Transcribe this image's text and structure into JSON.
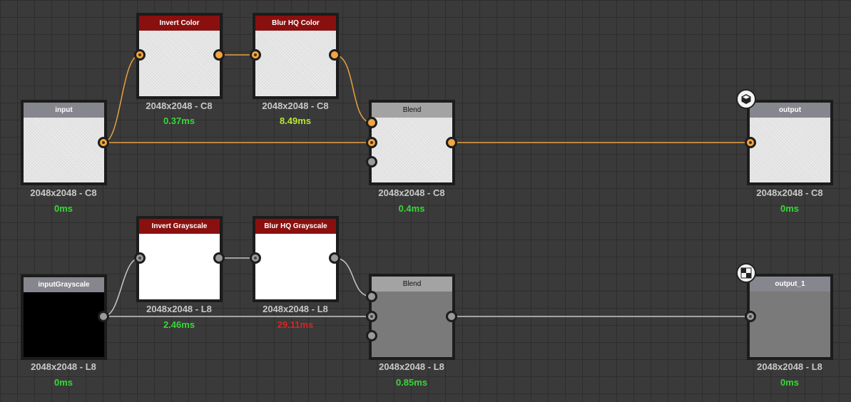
{
  "colors": {
    "color_wire": "#e8a040",
    "gray_wire": "#c8c8c8",
    "ok_time": "#36d836",
    "warn_time": "#b8e830",
    "bad_time": "#e02020"
  },
  "nodes": {
    "input": {
      "title": "input",
      "res": "2048x2048 - C8",
      "time": "0ms"
    },
    "invert_color": {
      "title": "Invert Color",
      "res": "2048x2048 - C8",
      "time": "0.37ms"
    },
    "blur_hq_color": {
      "title": "Blur HQ Color",
      "res": "2048x2048 - C8",
      "time": "8.49ms"
    },
    "blend_color": {
      "title": "Blend",
      "res": "2048x2048 - C8",
      "time": "0.4ms"
    },
    "output": {
      "title": "output",
      "res": "2048x2048 - C8",
      "time": "0ms",
      "badge_icon": "cube-icon"
    },
    "input_grayscale": {
      "title": "inputGrayscale",
      "res": "2048x2048 - L8",
      "time": "0ms"
    },
    "invert_grayscale": {
      "title": "Invert Grayscale",
      "res": "2048x2048 - L8",
      "time": "2.46ms"
    },
    "blur_hq_grayscale": {
      "title": "Blur HQ Grayscale",
      "res": "2048x2048 - L8",
      "time": "29.11ms"
    },
    "blend_grayscale": {
      "title": "Blend",
      "res": "2048x2048 - L8",
      "time": "0.85ms"
    },
    "output_1": {
      "title": "output_1",
      "res": "2048x2048 - L8",
      "time": "0ms",
      "badge_icon": "checker-icon"
    }
  }
}
